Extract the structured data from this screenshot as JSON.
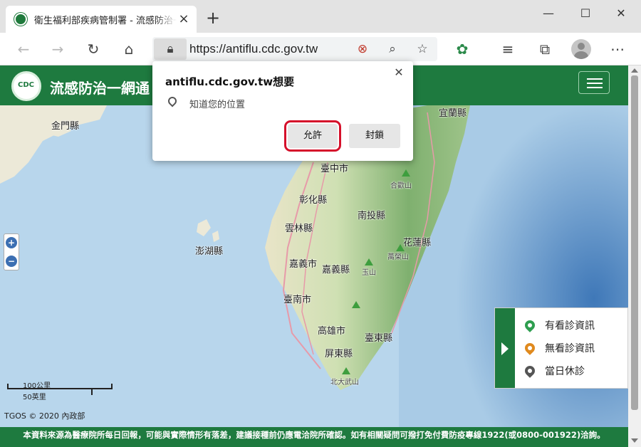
{
  "browser": {
    "tab_title": "衛生福利部疾病管制署 - 流感防治一網通",
    "url": "https://antiflu.cdc.gov.tw"
  },
  "site": {
    "title": "流感防治一網通"
  },
  "permission_popup": {
    "title": "antiflu.cdc.gov.tw想要",
    "request": "知道您的位置",
    "allow_label": "允許",
    "block_label": "封鎖"
  },
  "map": {
    "labels": {
      "kinmen": "金門縣",
      "penghu": "澎湖縣",
      "yilan": "宜蘭縣",
      "taichung": "臺中市",
      "changhua": "彰化縣",
      "nantou": "南投縣",
      "yunlin": "雲林縣",
      "hualien": "花蓮縣",
      "chiayi_city": "嘉義市",
      "chiayi_county": "嘉義縣",
      "tainan": "臺南市",
      "kaohsiung": "高雄市",
      "taitung": "臺東縣",
      "pingtung": "屏東縣",
      "hehuan": "合歡山",
      "yushan": "玉山",
      "wanrong": "萬榮山",
      "beidawu": "北大武山"
    },
    "scale_km": "100公里",
    "scale_mi": "50英里",
    "copyright": "TGOS © 2020 內政部"
  },
  "legend": {
    "items": [
      {
        "label": "有看診資訊",
        "color": "#2e9e4f"
      },
      {
        "label": "無看診資訊",
        "color": "#e08a1e"
      },
      {
        "label": "當日休診",
        "color": "#555555"
      }
    ]
  },
  "footer": {
    "text": "本資料來源為醫療院所每日回報，可能與實際情形有落差，建議接種前仍應電洽院所確認。如有相關疑問可撥打免付費防疫專線1922(或0800-001922)洽詢。"
  }
}
